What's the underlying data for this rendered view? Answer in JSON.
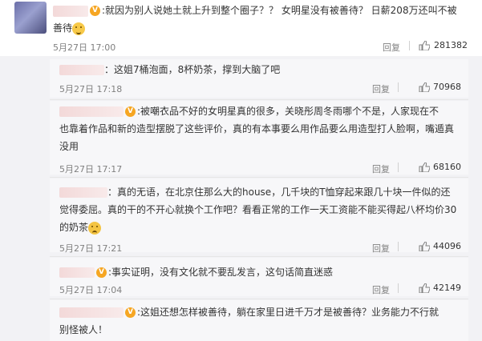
{
  "top": {
    "text_line1": ":就因为别人说她土就上升到整个圈子？？ 女明星没有被善待？ 日薪208万还叫不被",
    "text_line2": "善待",
    "emoji": "surprised-emoji",
    "time": "5月27日 17:00",
    "reply": "回复",
    "likes": "281382"
  },
  "replies": [
    {
      "lines": [
        "：这姐7桶泡面，8杯奶茶，撑到大脑了吧"
      ],
      "time": "5月27日 17:18",
      "reply": "回复",
      "likes": "70968"
    },
    {
      "lines": [
        ":被嘲衣品不好的女明星真的很多，关晓彤周冬雨哪个不是，人家现在不",
        "也靠着作品和新的造型摆脱了这些评价，真的有本事要么用作品要么用造型打人脸啊，嘴遁真",
        "没用"
      ],
      "time": "5月27日 17:17",
      "reply": "回复",
      "likes": "68160"
    },
    {
      "lines": [
        "：真的无语，在北京住那么大的house，几千块的T恤穿起来跟几十块一件似的还",
        "觉得委屈。真的干的不开心就换个工作吧？看看正常的工作一天工资能不能买得起八杯均价30",
        "的奶茶"
      ],
      "time": "5月27日 17:21",
      "reply": "回复",
      "likes": "44096"
    },
    {
      "lines": [
        ":事实证明，没有文化就不要乱发言，这句话简直迷惑"
      ],
      "time": "5月27日 17:04",
      "reply": "回复",
      "likes": "42149"
    },
    {
      "lines": [
        ":这姐还想怎样被善待，躺在家里日进千万才是被善待？业务能力不行就",
        "别怪被人！"
      ]
    }
  ]
}
